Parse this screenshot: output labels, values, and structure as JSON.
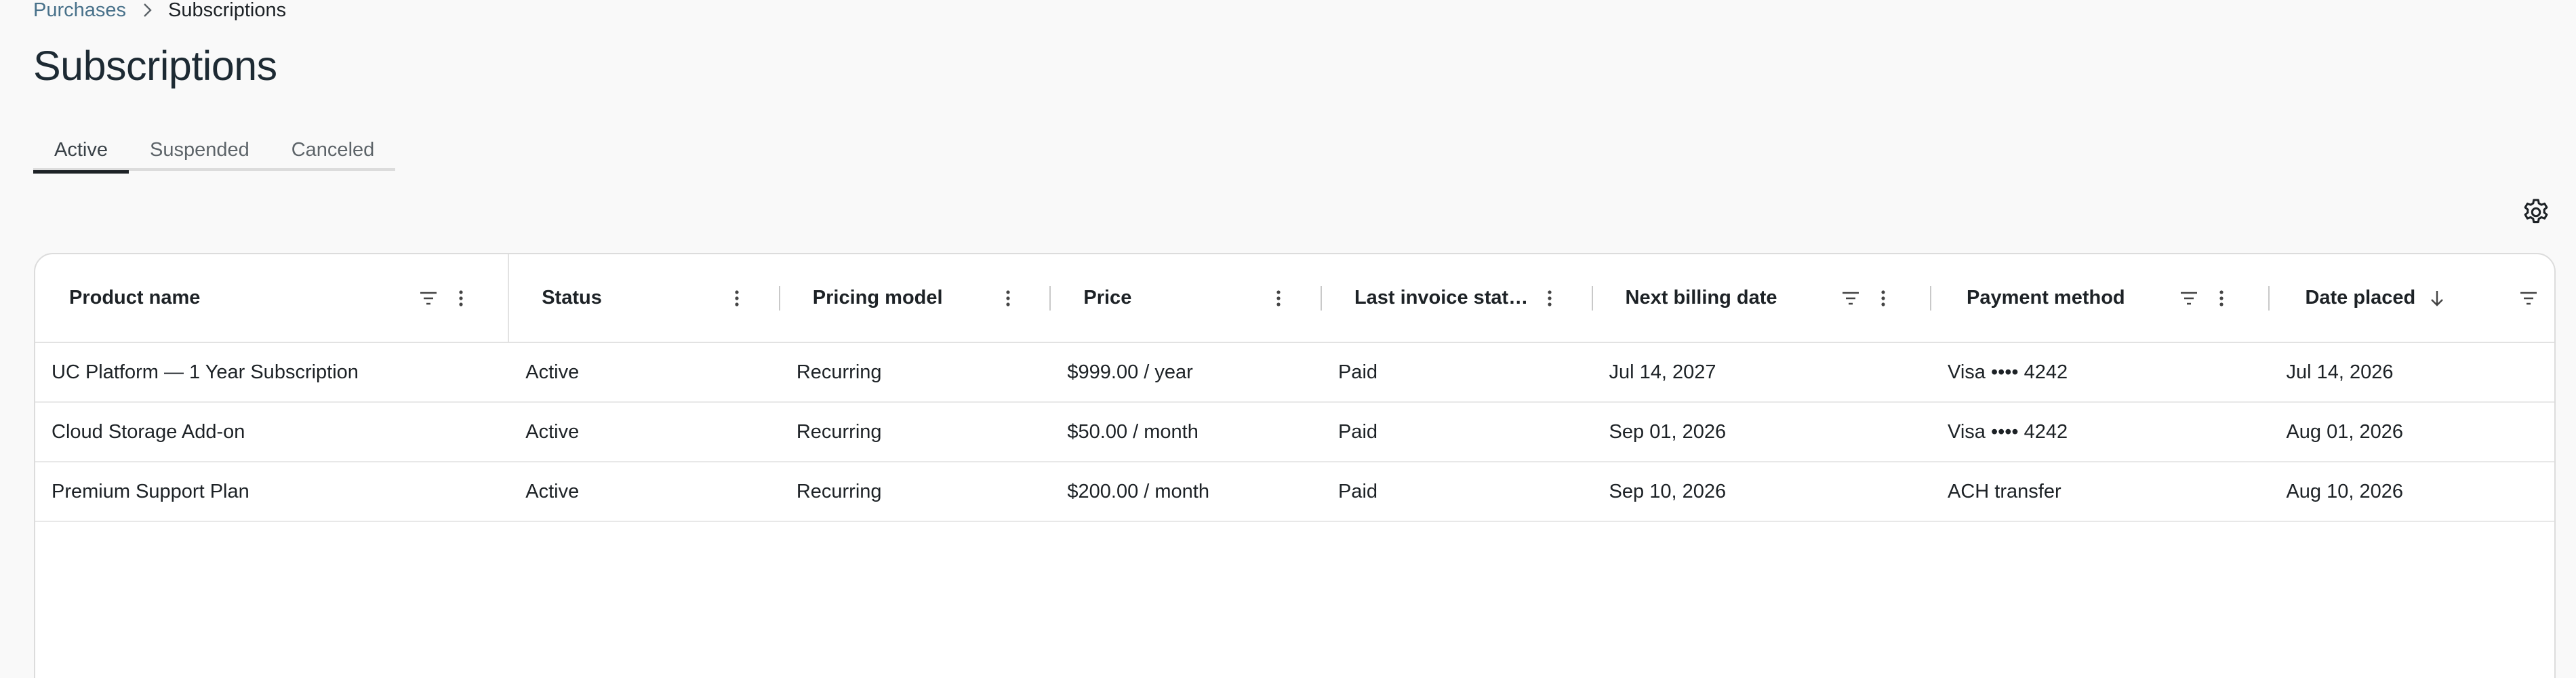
{
  "breadcrumb": {
    "parent": "Purchases",
    "current": "Subscriptions"
  },
  "page_title": "Subscriptions",
  "tabs": [
    {
      "label": "Active",
      "active": true
    },
    {
      "label": "Suspended",
      "active": false
    },
    {
      "label": "Canceled",
      "active": false
    }
  ],
  "settings_icon": "gear-icon",
  "table": {
    "columns": [
      {
        "label": "Product name",
        "filter": true,
        "menu": true
      },
      {
        "label": "Status",
        "filter": false,
        "menu": true
      },
      {
        "label": "Pricing model",
        "filter": false,
        "menu": true
      },
      {
        "label": "Price",
        "filter": false,
        "menu": true
      },
      {
        "label": "Last invoice stat…",
        "filter": false,
        "menu": true
      },
      {
        "label": "Next billing date",
        "filter": true,
        "menu": true
      },
      {
        "label": "Payment method",
        "filter": true,
        "menu": true
      },
      {
        "label": "Date placed",
        "filter": true,
        "menu": false,
        "sort": "descending"
      }
    ],
    "rows": [
      [
        "UC Platform — 1 Year Subscription",
        "Active",
        "Recurring",
        "$999.00 / year",
        "Paid",
        "Jul 14, 2027",
        "Visa •••• 4242",
        "Jul 14, 2026"
      ],
      [
        "Cloud Storage Add-on",
        "Active",
        "Recurring",
        "$50.00 / month",
        "Paid",
        "Sep 01, 2026",
        "Visa •••• 4242",
        "Aug 01, 2026"
      ],
      [
        "Premium Support Plan",
        "Active",
        "Recurring",
        "$200.00 / month",
        "Paid",
        "Sep 10, 2026",
        "ACH transfer",
        "Aug 10, 2026"
      ]
    ]
  },
  "colors": {
    "background": "#f9f9f9",
    "link": "#48718a",
    "text": "#1d2226",
    "border": "#dcdcdc"
  }
}
